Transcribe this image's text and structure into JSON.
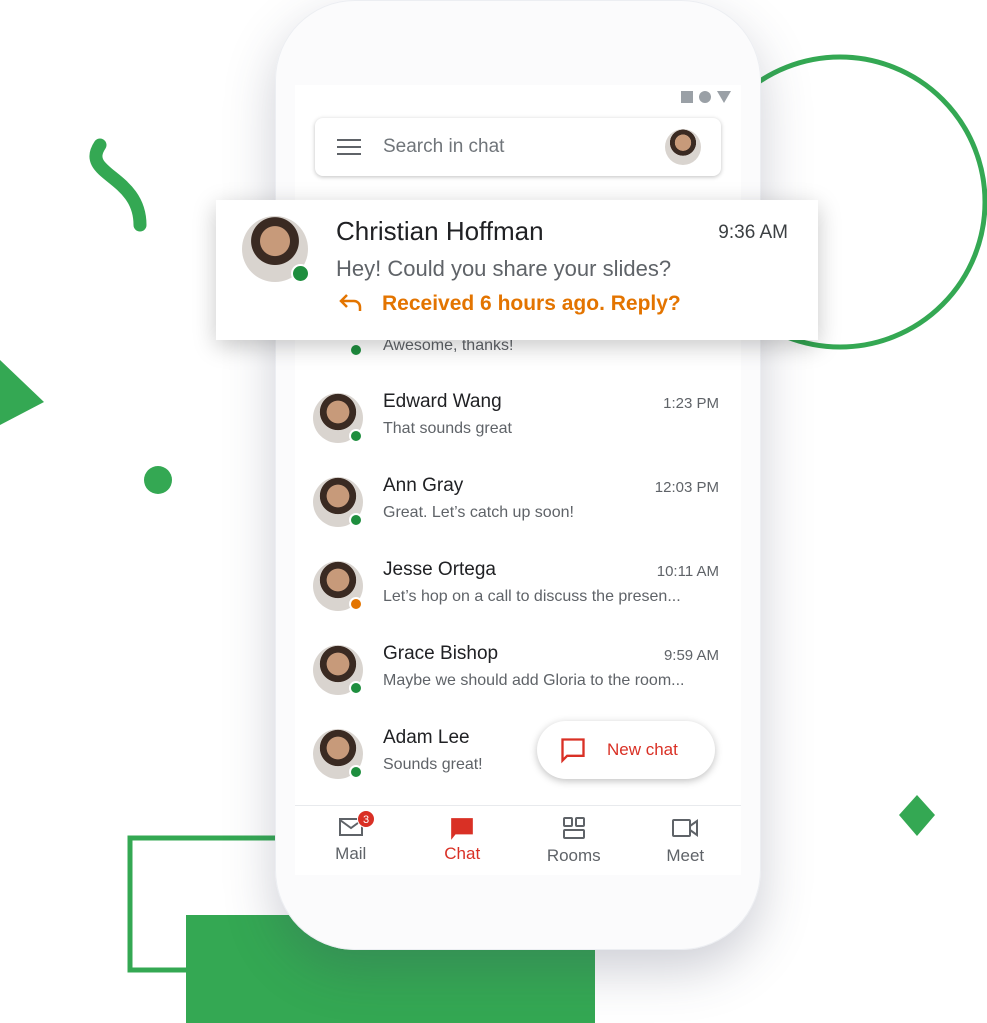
{
  "colors": {
    "accent_green": "#34a853",
    "chat_red": "#d93025",
    "reply_orange": "#e37400",
    "online": "#1e8e3e"
  },
  "search": {
    "placeholder": "Search in chat"
  },
  "featured": {
    "name": "Christian Hoffman",
    "time": "9:36 AM",
    "message": "Hey! Could you share your slides?",
    "reply_prompt": "Received 6 hours ago. Reply?",
    "status": "online"
  },
  "partial_row": {
    "message": "Awesome, thanks!"
  },
  "conversations": [
    {
      "name": "Edward Wang",
      "time": "1:23 PM",
      "message": "That sounds great",
      "status": "online"
    },
    {
      "name": "Ann Gray",
      "time": "12:03 PM",
      "message": "Great. Let’s catch up soon!",
      "status": "online"
    },
    {
      "name": "Jesse Ortega",
      "time": "10:11 AM",
      "message": "Let’s hop on a call to discuss the presen...",
      "status": "away"
    },
    {
      "name": "Grace Bishop",
      "time": "9:59 AM",
      "message": "Maybe we should add Gloria to the room...",
      "status": "online"
    },
    {
      "name": "Adam Lee",
      "time": "",
      "message": "Sounds great!",
      "status": "online"
    }
  ],
  "fab": {
    "label": "New chat"
  },
  "nav": [
    {
      "label": "Mail",
      "badge": "3",
      "icon": "mail-icon"
    },
    {
      "label": "Chat",
      "icon": "chat-icon",
      "active": true
    },
    {
      "label": "Rooms",
      "icon": "rooms-icon"
    },
    {
      "label": "Meet",
      "icon": "video-icon"
    }
  ]
}
